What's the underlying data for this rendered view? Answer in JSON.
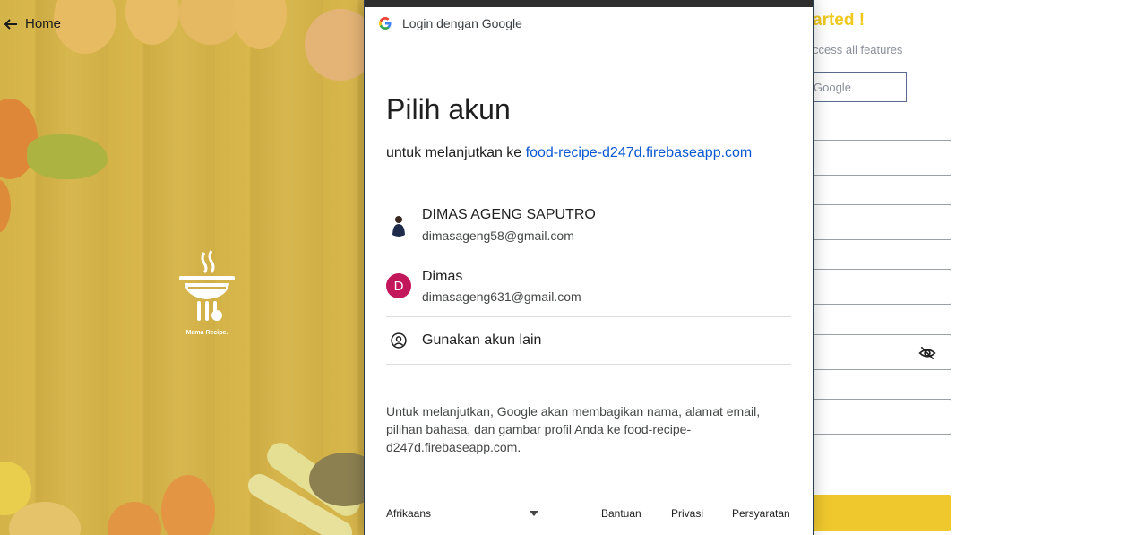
{
  "left_panel": {
    "home_label": "Home",
    "logo_text": "Mama Recipe."
  },
  "right_panel": {
    "title_fragment": "arted !",
    "subtitle_fragment": "ccess all features",
    "google_button_fragment": "Google",
    "accent_color": "#efc81a"
  },
  "popup": {
    "header_title": "Login dengan Google",
    "heading": "Pilih akun",
    "continue_prefix": "untuk melanjutkan ke",
    "continue_domain": "food-recipe-d247d.firebaseapp.com",
    "accounts": [
      {
        "name": "DIMAS AGENG SAPUTRO",
        "email": "dimasageng58@gmail.com",
        "avatar": "photo"
      },
      {
        "name": "Dimas",
        "email": "dimasageng631@gmail.com",
        "avatar_letter": "D",
        "avatar_color": "#c2185b"
      }
    ],
    "other_account_label": "Gunakan akun lain",
    "disclaimer": "Untuk melanjutkan, Google akan membagikan nama, alamat email, pilihan bahasa, dan gambar profil Anda ke food-recipe-d247d.firebaseapp.com.",
    "footer": {
      "language": "Afrikaans",
      "help": "Bantuan",
      "privacy": "Privasi",
      "terms": "Persyaratan"
    }
  }
}
